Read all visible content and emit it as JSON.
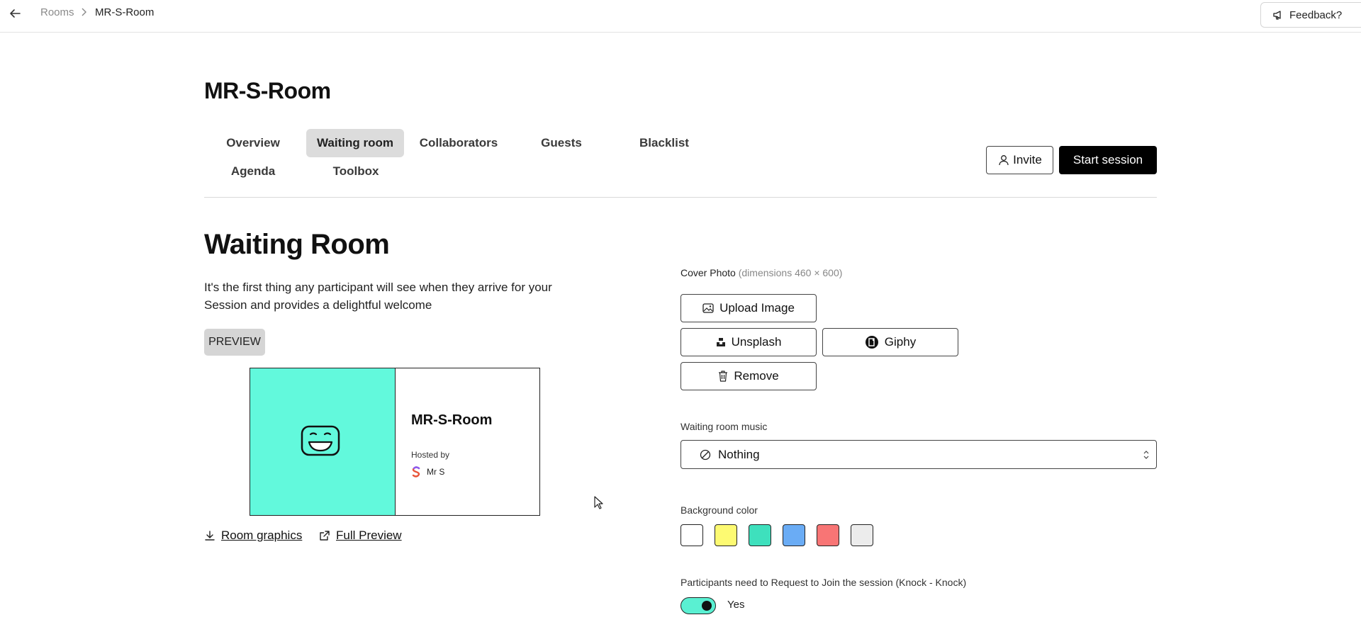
{
  "breadcrumb": {
    "rooms": "Rooms",
    "current": "MR-S-Room"
  },
  "feedback": {
    "label": "Feedback?"
  },
  "room": {
    "title": "MR-S-Room"
  },
  "tabs": [
    {
      "label": "Overview"
    },
    {
      "label": "Waiting room"
    },
    {
      "label": "Collaborators"
    },
    {
      "label": "Guests"
    },
    {
      "label": "Blacklist"
    },
    {
      "label": "Agenda"
    },
    {
      "label": "Toolbox"
    }
  ],
  "active_tab": "Waiting room",
  "actions": {
    "invite": "Invite",
    "start": "Start session"
  },
  "waiting_room": {
    "heading": "Waiting Room",
    "description": "It's the first thing any participant will see when they arrive for your Session and provides a delightful welcome",
    "preview_label": "PREVIEW"
  },
  "card": {
    "title": "MR-S-Room",
    "hosted_by": "Hosted by",
    "host_name": "Mr S",
    "cover_color": "#62f9dc"
  },
  "links": {
    "room_graphics": "Room graphics",
    "full_preview": "Full Preview"
  },
  "cover_photo": {
    "label": "Cover Photo",
    "hint": "(dimensions 460 × 600)",
    "upload": "Upload Image",
    "unsplash": "Unsplash",
    "giphy": "Giphy",
    "remove": "Remove"
  },
  "music": {
    "label": "Waiting room music",
    "selected": "Nothing"
  },
  "background": {
    "label": "Background color",
    "colors": [
      "#ffffff",
      "#fdfa72",
      "#3ee0bd",
      "#6aacf5",
      "#f87575",
      "#ececec"
    ]
  },
  "knock": {
    "label": "Participants need to Request to Join the session (Knock - Knock)",
    "value": "Yes",
    "enabled": true
  }
}
